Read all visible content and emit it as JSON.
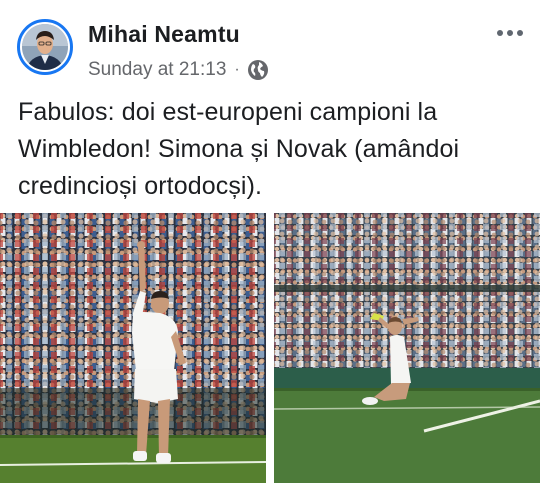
{
  "post": {
    "author": "Mihai Neamtu",
    "timestamp": "Sunday at 21:13",
    "separator": "·",
    "audience_icon": "globe-icon",
    "more_icon": "more-horizontal-icon",
    "text": "Fabulos: doi est-europeni campioni la Wimbledon! Simona și Novak (amândoi credincioși ortodocși).",
    "photos": [
      {
        "name": "photo-novak"
      },
      {
        "name": "photo-simona"
      }
    ]
  },
  "colors": {
    "accent": "#1877f2",
    "text": "#1c1e21",
    "secondary_text": "#65676b",
    "grass": "#4f7a2c"
  }
}
